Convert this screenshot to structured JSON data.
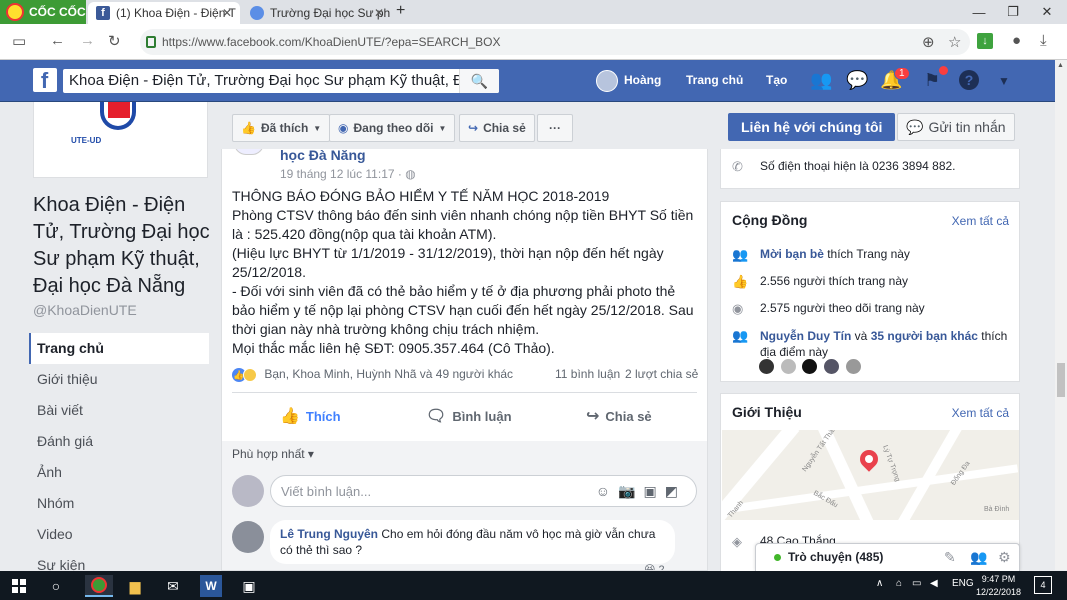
{
  "browser": {
    "brand": "CỐC CỐC",
    "tabs": [
      {
        "title": "(1) Khoa Điện - Điện T"
      },
      {
        "title": "Trường Đại học Sư ph"
      }
    ],
    "new_tab": "+",
    "url": "https://www.facebook.com/KhoaDienUTE/?epa=SEARCH_BOX",
    "download_label": "↓"
  },
  "fb_header": {
    "logo": "f",
    "search_value": "Khoa Điện - Điện Tử, Trường Đại học Sư phạm Kỹ thuật, Đ...",
    "user_name": "Hoàng",
    "home": "Trang chủ",
    "create": "Tạo",
    "notif_count": "1",
    "help": "?"
  },
  "page": {
    "logo_text": "UTE-UD",
    "name": "Khoa Điện - Điện Tử, Trường Đại học Sư phạm Kỹ thuật, Đại học Đà Nẵng",
    "handle": "@KhoaDienUTE",
    "nav": [
      "Trang chủ",
      "Giới thiệu",
      "Bài viết",
      "Đánh giá",
      "Ảnh",
      "Nhóm",
      "Video",
      "Sự kiện"
    ]
  },
  "actions": {
    "liked": "Đã thích",
    "following": "Đang theo dõi",
    "share": "Chia sẻ",
    "more": "···",
    "contact": "Liên hệ với chúng tôi",
    "message": "Gửi tin nhắn"
  },
  "post": {
    "author": "học Đà Nẵng",
    "time": "19 tháng 12 lúc 11:17 · ",
    "body": [
      "THÔNG BÁO ĐÓNG BẢO HIỂM Y TẾ NĂM HỌC 2018-2019",
      "Phòng CTSV thông báo đến sinh viên nhanh chóng nộp tiền BHYT Số tiền là : 525.420 đồng(nộp qua tài khoản ATM).",
      "(Hiệu lực BHYT từ 1/1/2019 - 31/12/2019), thời hạn nộp đến hết ngày 25/12/2018.",
      "- Đối với sinh viên đã có thẻ bảo hiểm y tế ở địa phương phải photo thẻ bảo hiểm y tế nộp lại phòng CTSV hạn cuối đến hết ngày 25/12/2018. Sau thời gian này nhà trường không chịu trách nhiệm.",
      "Mọi thắc mắc liên hệ SĐT: 0905.357.464 (Cô Thảo)."
    ],
    "reactions_text": "Bạn, Khoa Minh, Huỳnh Nhã và 49 người khác",
    "comments_count": "11 bình luận",
    "shares_count": "2 lượt chia sẻ",
    "like_btn": "Thích",
    "comment_btn": "Bình luận",
    "share_btn": "Chia sẻ",
    "sort": "Phù hợp nhất ▾",
    "comment_placeholder": "Viết bình luận...",
    "comment": {
      "name": "Lê Trung Nguyên",
      "text": "Cho em hỏi đóng đầu năm vô học mà giờ vẫn chưa có thẻ thì sao ?",
      "reaction_count": "2"
    }
  },
  "right": {
    "phone": "Số điện thoại hiện là 0236 3894 882.",
    "community": {
      "title": "Cộng Đồng",
      "see_all": "Xem tất cả",
      "invite_bold": "Mời bạn bè",
      "invite_rest": " thích Trang này",
      "likes": "2.556 người thích trang này",
      "follows": "2.575 người theo dõi trang này",
      "friend_bold": "Nguyễn Duy Tín",
      "friend_mid": " và ",
      "friend_bold2": "35 người bạn khác",
      "friend_rest": " thích địa điểm này"
    },
    "intro": {
      "title": "Giới Thiệu",
      "see_all": "Xem tất cả",
      "address": "48 Cao Thắng",
      "map_labels": [
        "Nguyễn Tất Thành",
        "Lý Tự Trọng",
        "Bắc Đẩu",
        "Đống Đa",
        "Bà Đình",
        "Thanh"
      ]
    }
  },
  "chat": {
    "label": "Trò chuyện (485)"
  },
  "taskbar": {
    "lang": "ENG",
    "time": "9:47 PM",
    "date": "12/22/2018",
    "notif": "4"
  }
}
